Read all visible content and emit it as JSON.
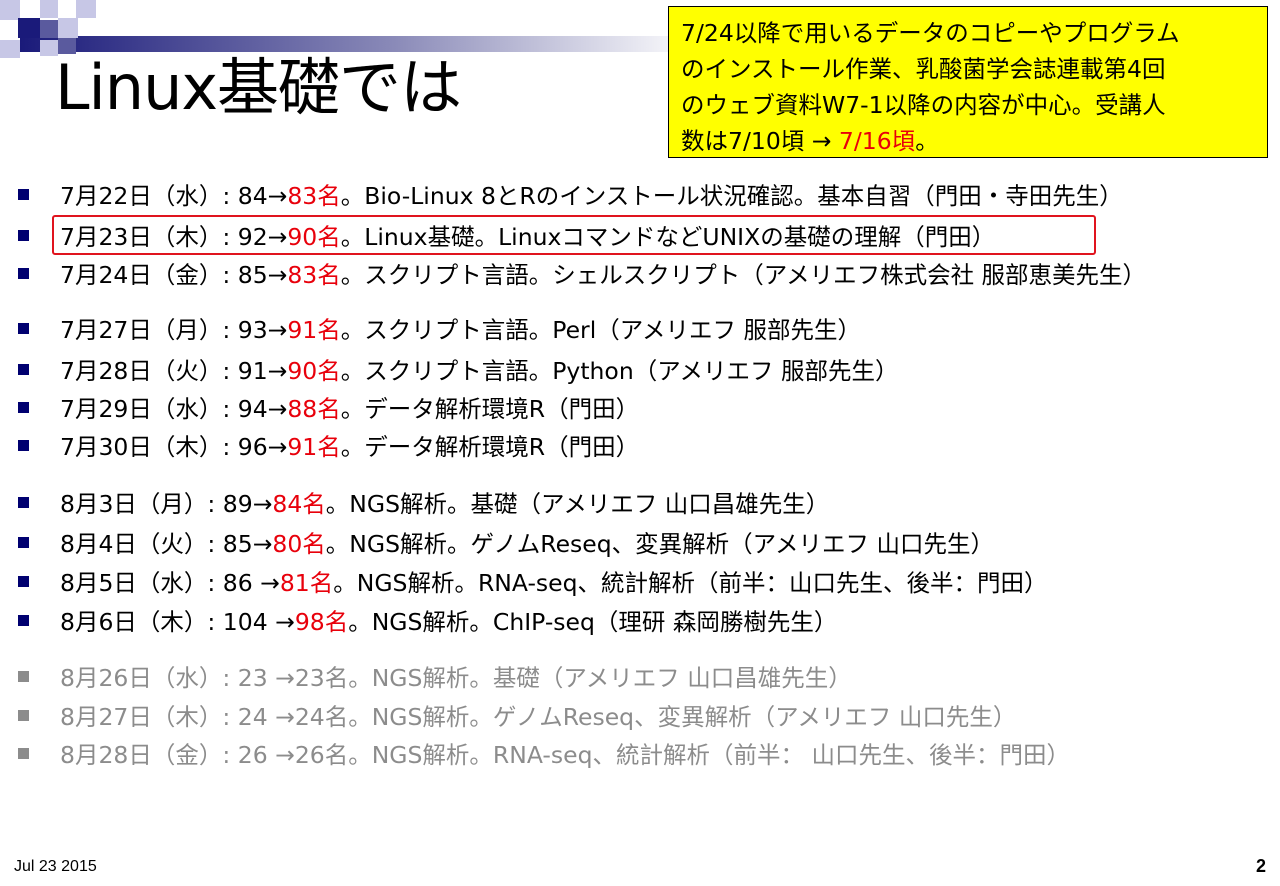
{
  "slide": {
    "title": "Linux基礎では",
    "note": {
      "line1": "7/24以降で用いるデータのコピーやプログラム",
      "line2": "のインストール作業、乳酸菌学会誌連載第4回",
      "line3": "のウェブ資料W7-1以降の内容が中心。受講人",
      "line4_prefix": "数は7/10頃 → ",
      "line4_red": "7/16頃",
      "line4_suffix": "。"
    },
    "items": [
      {
        "date": "7月22日（水）: 84→",
        "count": "83名",
        "desc": "。Bio-Linux 8とRのインストール状況確認。基本自習（門田・寺田先生）"
      },
      {
        "date": "7月23日（木）: 92→",
        "count": "90名",
        "desc": "。Linux基礎。LinuxコマンドなどUNIXの基礎の理解（門田）"
      },
      {
        "date": "7月24日（金）: 85→",
        "count": "83名",
        "desc": "。スクリプト言語。シェルスクリプト（アメリエフ株式会社 服部恵美先生）"
      },
      {
        "date": "7月27日（月）: 93→",
        "count": "91名",
        "desc": "。スクリプト言語。Perl（アメリエフ 服部先生）"
      },
      {
        "date": "7月28日（火）: 91→",
        "count": "90名",
        "desc": "。スクリプト言語。Python（アメリエフ 服部先生）"
      },
      {
        "date": "7月29日（水）: 94→",
        "count": "88名",
        "desc": "。データ解析環境R（門田）"
      },
      {
        "date": "7月30日（木）: 96→",
        "count": "91名",
        "desc": "。データ解析環境R（門田）"
      },
      {
        "date": "8月3日（月）: 89→",
        "count": "84名",
        "desc": "。NGS解析。基礎（アメリエフ 山口昌雄先生）"
      },
      {
        "date": "8月4日（火）: 85→",
        "count": "80名",
        "desc": "。NGS解析。ゲノムReseq、変異解析（アメリエフ 山口先生）"
      },
      {
        "date": "8月5日（水）: 86 →",
        "count": "81名",
        "desc": "。NGS解析。RNA-seq、統計解析（前半：山口先生、後半：門田）"
      },
      {
        "date": "8月6日（木）: 104 →",
        "count": "98名",
        "desc": "。NGS解析。ChIP-seq（理研 森岡勝樹先生）"
      },
      {
        "date": "8月26日（水）: 23 →",
        "count": "23名",
        "desc": "。NGS解析。基礎（アメリエフ 山口昌雄先生）"
      },
      {
        "date": "8月27日（木）: 24 →",
        "count": "24名",
        "desc": "。NGS解析。ゲノムReseq、変異解析（アメリエフ 山口先生）"
      },
      {
        "date": "8月28日（金）: 26 →",
        "count": "26名",
        "desc": "。NGS解析。RNA-seq、統計解析（前半： 山口先生、後半：門田）"
      }
    ],
    "footer_date": "Jul 23 2015",
    "page_number": "2",
    "colors": {
      "accent_red": "#e8000b",
      "note_bg": "#ffff00",
      "bullet": "#000070",
      "dim_text": "#8c8c8c",
      "deco_navy": "#1a1a7a"
    }
  }
}
